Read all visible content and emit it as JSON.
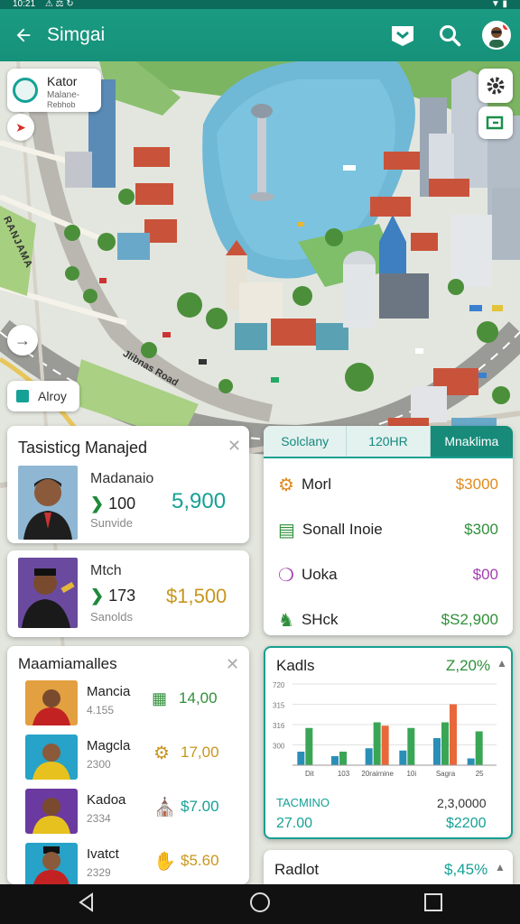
{
  "status": {
    "time": "10:21",
    "icons_left": "⚠ ⚖ ↻",
    "icons_right": "▼ ▮"
  },
  "appbar": {
    "title": "Simgai"
  },
  "map": {
    "location_card": {
      "title": "Kator",
      "line1": "Malane-",
      "line2": "Rebhob"
    },
    "street_label_1": "RANJAMA",
    "street_label_2": "Jlibnas Road",
    "chip": {
      "label": "Alroy"
    }
  },
  "card_manager1": {
    "title": "Tasisticg Manajed",
    "name": "Madanaio",
    "number": "100",
    "sub": "Sunvide",
    "amount": "5,900"
  },
  "card_manager2": {
    "name": "Mtch",
    "number": "173",
    "sub": "Sanolds",
    "amount": "$1,500"
  },
  "tabs": [
    "Solclany",
    "120HR",
    "Mnaklima"
  ],
  "prices": [
    {
      "label": "Morl",
      "value": "$3000",
      "icon": "gears-icon",
      "color": "#e08a1d"
    },
    {
      "label": "Sonall Inoie",
      "value": "$300",
      "icon": "calendar-icon",
      "color": "#2f8f3a"
    },
    {
      "label": "Uoka",
      "value": "$00",
      "icon": "wrench-icon",
      "color": "#a33fb0"
    },
    {
      "label": "SHck",
      "value": "$S2,900",
      "icon": "horse-icon",
      "color": "#2f8f3a"
    }
  ],
  "list": {
    "title": "Maamiamalles",
    "items": [
      {
        "name": "Mancia",
        "sub": "4.155",
        "value": "14,00",
        "icon": "factory-icon",
        "color": "#2f8f3a"
      },
      {
        "name": "Magcla",
        "sub": "2300",
        "value": "17,00",
        "icon": "gear-icon",
        "color": "#c8961e"
      },
      {
        "name": "Kadoa",
        "sub": "2334",
        "value": "$7.00",
        "icon": "building-icon",
        "color": "#15a196"
      },
      {
        "name": "Ivatct",
        "sub": "2329",
        "value": "$5.60",
        "icon": "hand-icon",
        "color": "#c8961e"
      }
    ]
  },
  "chart_card": {
    "title": "Kadls",
    "badge": "Z,20%",
    "bottom_label": "TACMINO",
    "bottom_value": "2,3,0000",
    "left_total": "27.00",
    "right_total": "$2200"
  },
  "chart_data": {
    "type": "bar",
    "categories": [
      "Dit",
      "103",
      "20rairnine",
      "10i",
      "Sagra",
      "25"
    ],
    "ylim": [
      0,
      720
    ],
    "yticks": [
      "720",
      "315",
      "316",
      "300"
    ],
    "series": [
      {
        "values": [
          120,
          80,
          150,
          130,
          240,
          60
        ],
        "color": "#2a8fb6"
      },
      {
        "values": [
          330,
          120,
          380,
          330,
          380,
          300
        ],
        "color": "#3aa655"
      },
      {
        "values": [
          0,
          0,
          350,
          0,
          540,
          0
        ],
        "color": "#e9683b"
      }
    ]
  },
  "bottom_card": {
    "title": "Radlot",
    "value": "$,45%"
  }
}
